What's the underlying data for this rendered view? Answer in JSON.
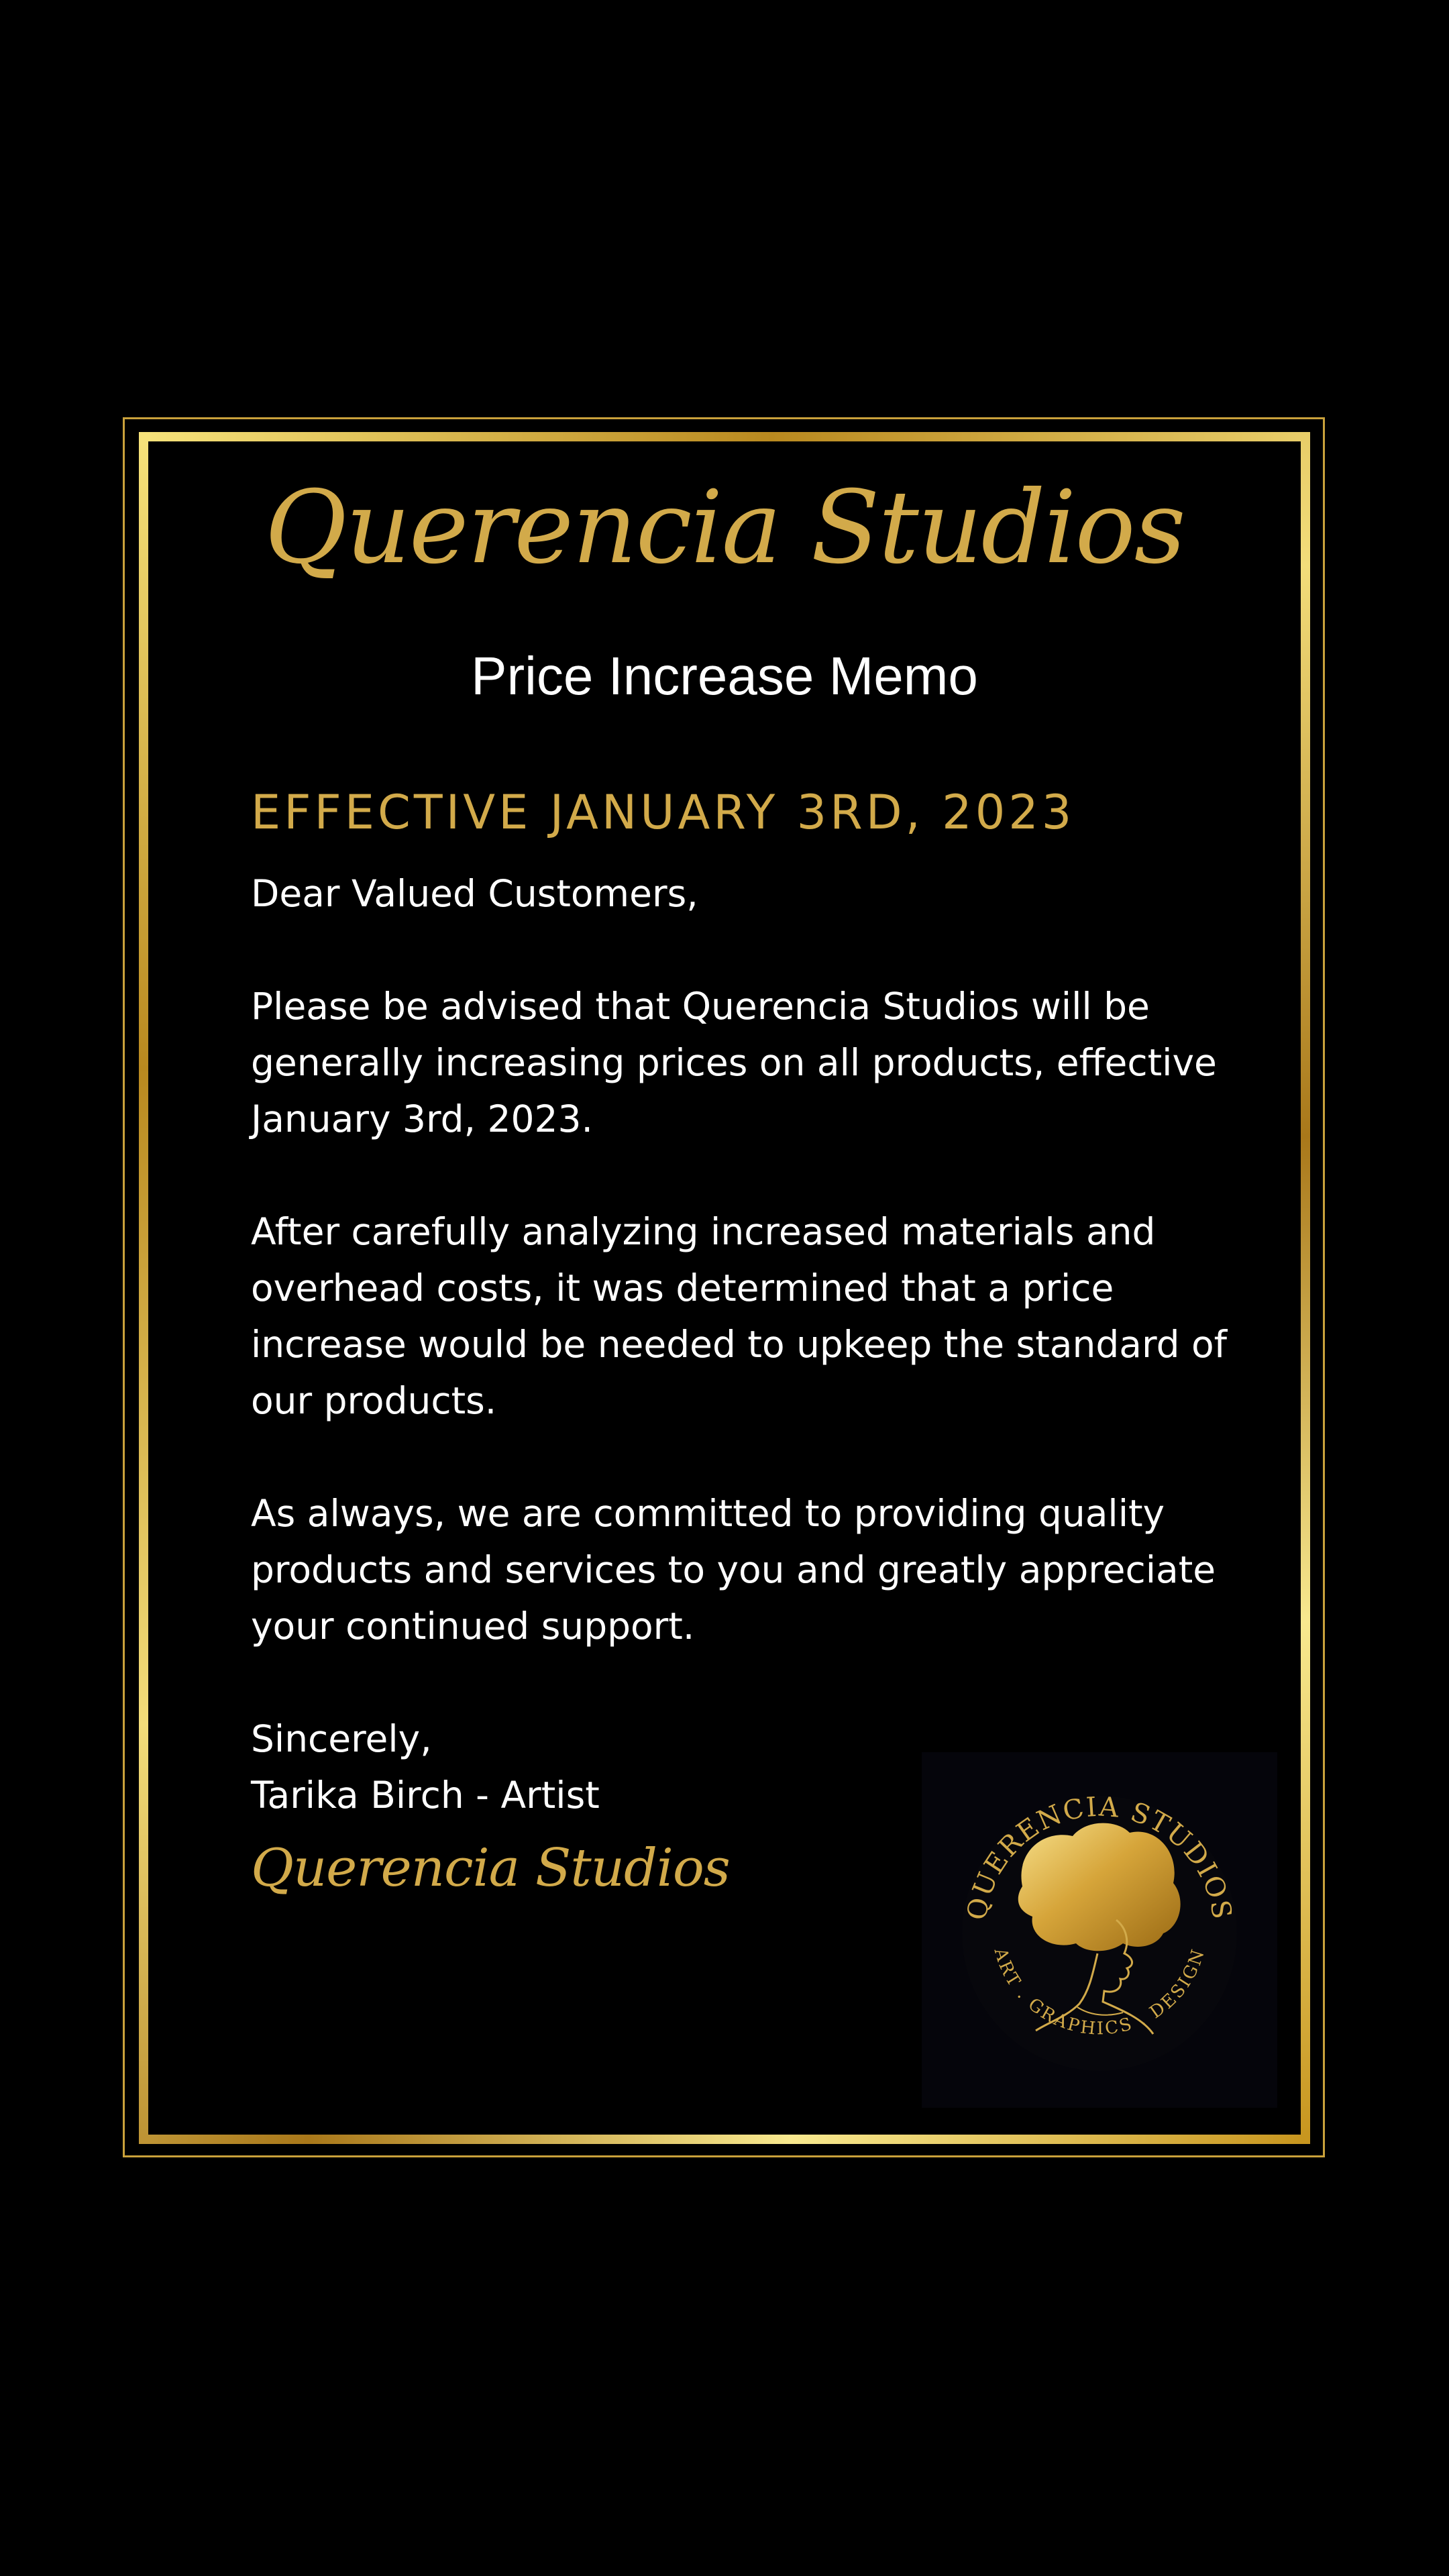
{
  "header": {
    "brand": "Querencia Studios",
    "memo_title": "Price Increase Memo",
    "effective": "EFFECTIVE JANUARY 3RD, 2023"
  },
  "letter": {
    "greeting": "Dear Valued Customers,",
    "paragraphs": [
      "Please be advised that Querencia Studios will be generally increasing prices on all products, effective January 3rd, 2023.",
      "After carefully analyzing increased materials and overhead costs, it was determined that a price increase would be needed to upkeep the standard of our products.",
      "As always, we are committed to providing quality products and services to you and greatly appreciate your continued support."
    ],
    "closing": "Sincerely,",
    "signer": "Tarika Birch - Artist",
    "signature_brand": "Querencia Studios"
  },
  "logo": {
    "top_text": "QUERENCIA STUDIOS",
    "bottom_text": "ART . GRAPHICS . DESIGN",
    "icon": "woman-silhouette-afro-icon"
  },
  "colors": {
    "background": "#000000",
    "gold": "#d2aa4a",
    "text": "#ffffff"
  }
}
